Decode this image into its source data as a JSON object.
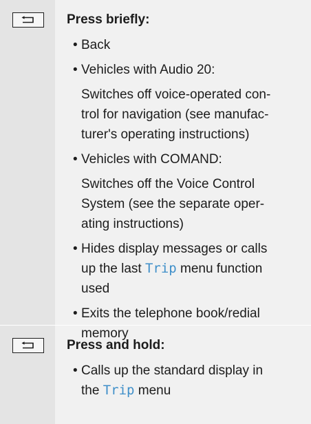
{
  "rows": [
    {
      "icon": "back-key-icon",
      "heading": "Press briefly:",
      "items": [
        {
          "lines": [
            "Back"
          ]
        },
        {
          "lines": [
            "Vehicles with Audio 20:"
          ],
          "sub_lines": [
            "Switches off voice-operated con-",
            "trol for navigation (see manufac-",
            "turer's operating instructions)"
          ]
        },
        {
          "lines": [
            "Vehicles with COMAND:"
          ],
          "sub_lines": [
            "Switches off the Voice Control",
            "System (see the separate oper-",
            "ating instructions)"
          ]
        },
        {
          "line1": "Hides display messages or calls",
          "line2_before": "up the last ",
          "line2_keyword": "Trip",
          "line2_after": " menu function",
          "line3": "used"
        },
        {
          "lines": [
            "Exits the telephone book/redial",
            "memory"
          ]
        }
      ]
    },
    {
      "icon": "back-key-icon",
      "heading": "Press and hold:",
      "items": [
        {
          "line1": "Calls up the standard display in",
          "line2_before": "the ",
          "line2_keyword": "Trip",
          "line2_after": " menu"
        }
      ]
    }
  ],
  "bullet_char": "•",
  "colors": {
    "icon_column_bg": "#e4e4e4",
    "text_column_bg": "#f1f1f1",
    "keyword": "#3f8fc9",
    "text": "#1c1c1c"
  }
}
